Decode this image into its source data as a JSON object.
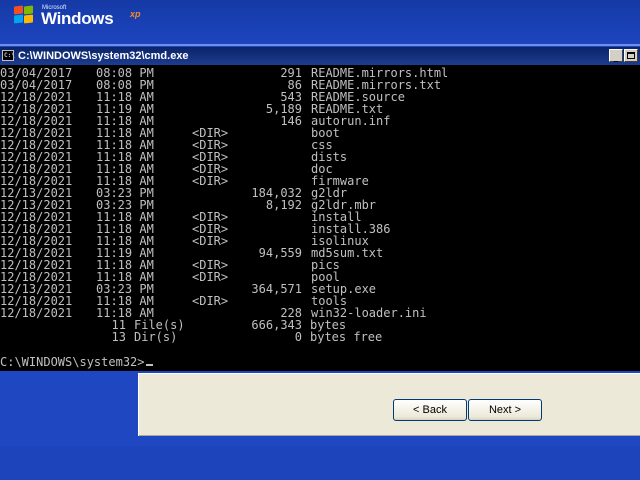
{
  "desktop": {
    "logo": {
      "small_text": "Microsoft",
      "word": "Windows",
      "edition": "xp"
    }
  },
  "window": {
    "title": "C:\\WINDOWS\\system32\\cmd.exe",
    "icon": "cmd-icon",
    "minimize_label": "_"
  },
  "console": {
    "entries": [
      {
        "date": "03/04/2017",
        "time": "08:08 PM",
        "dir": "",
        "size": "291",
        "name": "README.mirrors.html"
      },
      {
        "date": "03/04/2017",
        "time": "08:08 PM",
        "dir": "",
        "size": "86",
        "name": "README.mirrors.txt"
      },
      {
        "date": "12/18/2021",
        "time": "11:18 AM",
        "dir": "",
        "size": "543",
        "name": "README.source"
      },
      {
        "date": "12/18/2021",
        "time": "11:19 AM",
        "dir": "",
        "size": "5,189",
        "name": "README.txt"
      },
      {
        "date": "12/18/2021",
        "time": "11:18 AM",
        "dir": "",
        "size": "146",
        "name": "autorun.inf"
      },
      {
        "date": "12/18/2021",
        "time": "11:18 AM",
        "dir": "<DIR>",
        "size": "",
        "name": "boot"
      },
      {
        "date": "12/18/2021",
        "time": "11:18 AM",
        "dir": "<DIR>",
        "size": "",
        "name": "css"
      },
      {
        "date": "12/18/2021",
        "time": "11:18 AM",
        "dir": "<DIR>",
        "size": "",
        "name": "dists"
      },
      {
        "date": "12/18/2021",
        "time": "11:18 AM",
        "dir": "<DIR>",
        "size": "",
        "name": "doc"
      },
      {
        "date": "12/18/2021",
        "time": "11:18 AM",
        "dir": "<DIR>",
        "size": "",
        "name": "firmware"
      },
      {
        "date": "12/13/2021",
        "time": "03:23 PM",
        "dir": "",
        "size": "184,032",
        "name": "g2ldr"
      },
      {
        "date": "12/13/2021",
        "time": "03:23 PM",
        "dir": "",
        "size": "8,192",
        "name": "g2ldr.mbr"
      },
      {
        "date": "12/18/2021",
        "time": "11:18 AM",
        "dir": "<DIR>",
        "size": "",
        "name": "install"
      },
      {
        "date": "12/18/2021",
        "time": "11:18 AM",
        "dir": "<DIR>",
        "size": "",
        "name": "install.386"
      },
      {
        "date": "12/18/2021",
        "time": "11:18 AM",
        "dir": "<DIR>",
        "size": "",
        "name": "isolinux"
      },
      {
        "date": "12/18/2021",
        "time": "11:19 AM",
        "dir": "",
        "size": "94,559",
        "name": "md5sum.txt"
      },
      {
        "date": "12/18/2021",
        "time": "11:18 AM",
        "dir": "<DIR>",
        "size": "",
        "name": "pics"
      },
      {
        "date": "12/18/2021",
        "time": "11:18 AM",
        "dir": "<DIR>",
        "size": "",
        "name": "pool"
      },
      {
        "date": "12/13/2021",
        "time": "03:23 PM",
        "dir": "",
        "size": "364,571",
        "name": "setup.exe"
      },
      {
        "date": "12/18/2021",
        "time": "11:18 AM",
        "dir": "<DIR>",
        "size": "",
        "name": "tools"
      },
      {
        "date": "12/18/2021",
        "time": "11:18 AM",
        "dir": "",
        "size": "228",
        "name": "win32-loader.ini"
      }
    ],
    "summary": [
      {
        "count": "11",
        "label": "File(s)",
        "amount": "666,343",
        "unit": "bytes"
      },
      {
        "count": "13",
        "label": "Dir(s)",
        "amount": "0",
        "unit": "bytes free"
      }
    ],
    "prompt": "C:\\WINDOWS\\system32>"
  },
  "wizard": {
    "back_label": "< Back",
    "next_label": "Next >"
  },
  "colors": {
    "desktop_blue": "#1f47c2",
    "console_bg": "#000000",
    "console_text": "#c0c0c0",
    "title_bar": "#0a246a",
    "panel": "#ece9d8"
  }
}
